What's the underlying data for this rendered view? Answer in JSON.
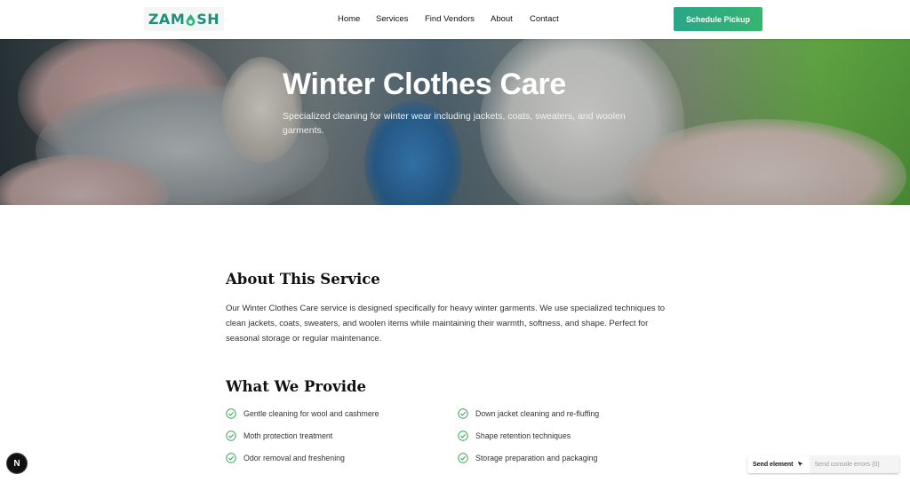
{
  "header": {
    "logo_text_left": "ZAM",
    "logo_text_right": "SH",
    "nav": [
      "Home",
      "Services",
      "Find Vendors",
      "About",
      "Contact"
    ],
    "cta_label": "Schedule Pickup"
  },
  "hero": {
    "title": "Winter Clothes Care",
    "subtitle": "Specialized cleaning for winter wear including jackets, coats, sweaters, and woolen garments."
  },
  "about": {
    "title": "About This Service",
    "text": "Our Winter Clothes Care service is designed specifically for heavy winter garments. We use specialized techniques to clean jackets, coats, sweaters, and woolen items while maintaining their warmth, softness, and shape. Perfect for seasonal storage or regular maintenance."
  },
  "provide": {
    "title": "What We Provide",
    "items": [
      "Gentle cleaning for wool and cashmere",
      "Down jacket cleaning and re-fluffing",
      "Moth protection treatment",
      "Shape retention techniques",
      "Odor removal and freshening",
      "Storage preparation and packaging"
    ]
  },
  "devtools": {
    "badge": "N",
    "send_element": "Send element",
    "send_errors": "Send console errors (0)"
  },
  "colors": {
    "accent": "#2aa58a",
    "check": "#3aa65a"
  }
}
